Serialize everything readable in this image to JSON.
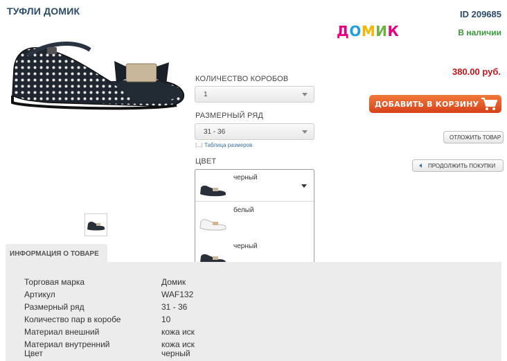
{
  "product": {
    "title": "ТУФЛИ ДОМИК",
    "id_label": "ID 209685",
    "brand_letters": [
      "Д",
      "О",
      "М",
      "И",
      "К"
    ],
    "brand_colors": [
      "#e6007e",
      "#1ea0dc",
      "#f7b500",
      "#6cb33f",
      "#e6007e"
    ],
    "stock": "В наличии",
    "price": "380.00 руб."
  },
  "form": {
    "qty_label": "КОЛИЧЕСТВО КОРОБОВ",
    "qty_value": "1",
    "size_label": "РАЗМЕРНЫЙ РЯД",
    "size_value": "31 - 36",
    "size_table_prefix": "|...|",
    "size_table_link": "Таблица размеров",
    "color_label": "ЦВЕТ",
    "color_selected": "черный",
    "color_options": [
      {
        "name": "белый"
      },
      {
        "name": "черный"
      }
    ]
  },
  "actions": {
    "add_to_cart": "ДОБАВИТЬ В КОРЗИНУ",
    "postpone": "ОТЛОЖИТЬ ТОВАР",
    "continue": "ПРОДОЛЖИТЬ ПОКУПКИ"
  },
  "info": {
    "tab_label": "ИНФОРМАЦИЯ О ТОВАРЕ",
    "specs": [
      {
        "k": "Торговая марка",
        "v": "Домик"
      },
      {
        "k": "Артикул",
        "v": "WAF132"
      },
      {
        "k": "Размерный ряд",
        "v": "31 - 36"
      },
      {
        "k": "Количество пар в коробе",
        "v": "10"
      },
      {
        "k": "Материал внешний",
        "v": "кожа иск"
      },
      {
        "k": "Материал внутренний",
        "v": "кожа иск"
      },
      {
        "k": "Цвет",
        "v": "черный"
      }
    ]
  },
  "colors": {
    "title": "#2c4a6b",
    "stock": "#3a9a3a",
    "price": "#c4141b",
    "cart_button": "#e05a2a",
    "link": "#3a6ea5",
    "panel": "#ececec"
  }
}
